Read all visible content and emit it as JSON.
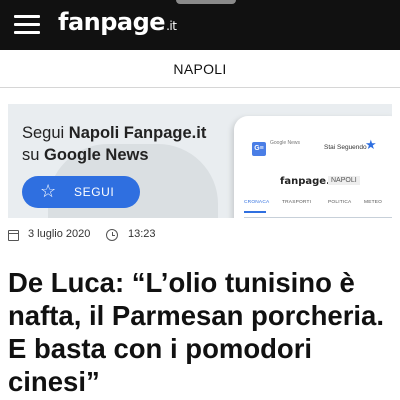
{
  "header": {
    "logo_text": "fanpage",
    "logo_tld": ".it",
    "menu_icon": "hamburger-menu-icon"
  },
  "section": {
    "name": "NAPOLI"
  },
  "banner": {
    "title_prefix": "Segui ",
    "title_bold": "Napoli Fanpage.it",
    "title_mid": " su ",
    "title_bold2": "Google News",
    "button_label": "SEGUI",
    "button_icon": "star-icon",
    "button_color": "#2f6fe0",
    "phone": {
      "app_icon_text": "G≡",
      "app_label": "Google News",
      "follow_status": "Stai Seguendo",
      "logo": "fanpage.it",
      "section": "NAPOLI",
      "tabs": [
        "CRONACA",
        "TRASPORTI",
        "POLITICA",
        "METEO"
      ]
    }
  },
  "meta": {
    "date": "3 luglio 2020",
    "time": "13:23",
    "date_icon": "calendar-icon",
    "time_icon": "clock-icon"
  },
  "article": {
    "headline": "De Luca: “L’olio tunisino è nafta, il Parmesan porcheria. E basta con i pomodori cinesi”"
  }
}
